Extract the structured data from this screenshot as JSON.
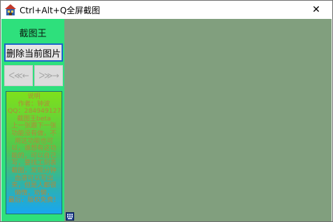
{
  "window": {
    "title": "Ctrl+Alt+Q全屏截图",
    "close_glyph": "✕",
    "app_icon": "house-icon"
  },
  "sidebar": {
    "title": "截图王",
    "delete_button": "删除当前图片",
    "prev_button": "ᐸ≪←",
    "next_button": "ᐳ≫→",
    "info_lines": [
      "说明",
      "作者：钟波",
      "QQ：284949127",
      "截图王beta",
      "上一张跟下一张",
      "功能没有做，不",
      "用这功能也可",
      "以，谁想有这功",
      "能的，可以自己",
      "写，要找工刻表",
      "截图，发现分钟",
      "血液可以写出",
      "来，但是人都很",
      "懒惰，劝懒，",
      "最后：版权免费！"
    ]
  },
  "colors": {
    "client_bg": "#819f7e",
    "sidebar_bg": "#2ee07c",
    "focus_border": "#1d64c8"
  },
  "status": {
    "keyboard_icon": "keyboard-icon"
  }
}
